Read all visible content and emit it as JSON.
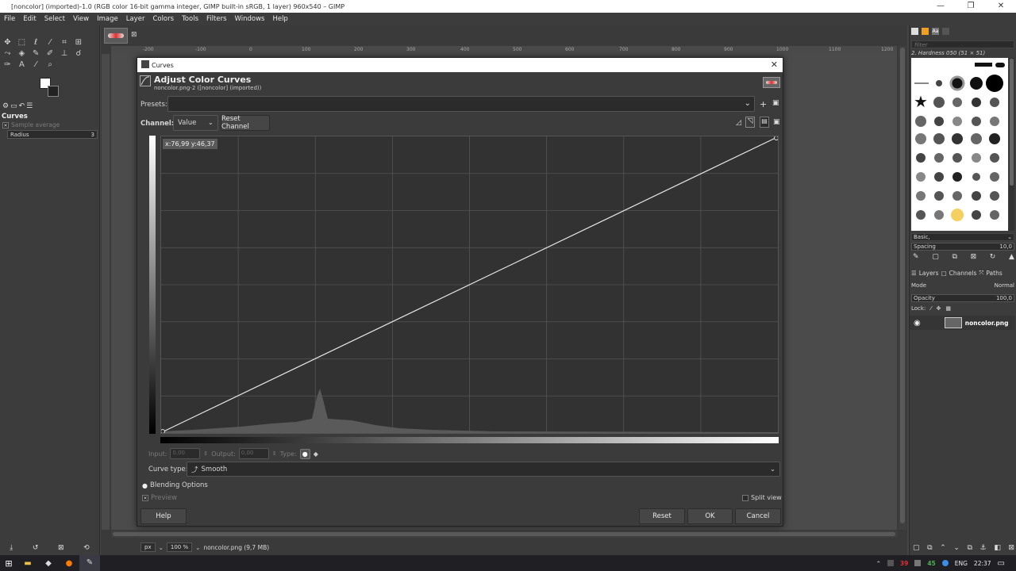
{
  "window": {
    "title": "[noncolor] (imported)-1.0 (RGB color 16-bit gamma integer, GIMP built-in sRGB, 1 layer) 960x540 – GIMP",
    "controls": [
      "—",
      "❐",
      "✕"
    ]
  },
  "menu": [
    "File",
    "Edit",
    "Select",
    "View",
    "Image",
    "Layer",
    "Colors",
    "Tools",
    "Filters",
    "Windows",
    "Help"
  ],
  "tool_options": {
    "title": "Curves",
    "sample_average_label": "Sample average",
    "radius_label": "Radius",
    "radius_value": "3"
  },
  "ruler": {
    "h_ticks": [
      "-200",
      "-100",
      "0",
      "100",
      "200",
      "300",
      "400",
      "500",
      "600",
      "700",
      "800",
      "900",
      "1000",
      "1100",
      "1200"
    ]
  },
  "status": {
    "unit": "px",
    "zoom": "100 %",
    "file_info": "noncolor.png (9,7 MB)"
  },
  "dialog": {
    "window_title": "Curves",
    "heading": "Adjust Color Curves",
    "subheading": "noncolor.png-2 ([noncolor] (imported))",
    "presets_label": "Presets:",
    "channel_label": "Channel:",
    "channel_value": "Value",
    "reset_channel_label": "Reset Channel",
    "coord_tooltip": "x:76,99 y:46,37",
    "input_label": "Input:",
    "input_value": "0,00",
    "output_label": "Output:",
    "output_value": "0,00",
    "type_label": "Type:",
    "curve_type_label": "Curve type:",
    "curve_type_value": "Smooth",
    "blending_options_label": "Blending Options",
    "preview_label": "Preview",
    "split_view_label": "Split view",
    "help_label": "Help",
    "reset_label": "Reset",
    "ok_label": "OK",
    "cancel_label": "Cancel"
  },
  "brushes": {
    "filter_placeholder": "filter",
    "selected_brush": "2. Hardness 050 (51 × 51)",
    "preset": "Basic,",
    "spacing_label": "Spacing",
    "spacing_value": "10,0"
  },
  "layers": {
    "tabs": [
      "Layers",
      "Channels",
      "Paths"
    ],
    "mode_label": "Mode",
    "mode_value": "Normal",
    "opacity_label": "Opacity",
    "opacity_value": "100,0",
    "lock_label": "Lock:",
    "layer_name": "noncolor.png"
  },
  "taskbar": {
    "tray_num_red": "39",
    "tray_num_green": "45",
    "language": "ENG",
    "clock": "22:37"
  },
  "colors": {
    "accent_red": "#e03030",
    "tray_green": "#4caf50"
  }
}
